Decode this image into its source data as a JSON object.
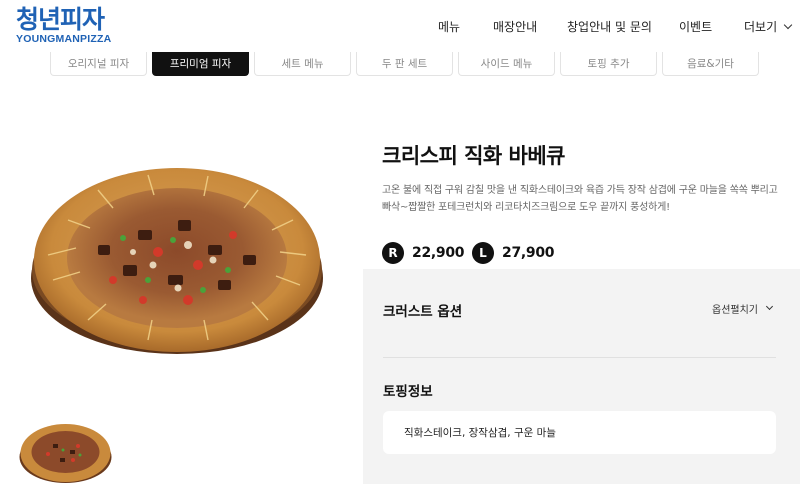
{
  "brand": {
    "logo_main": "청년피자",
    "logo_sub": "YOUNGMANPIZZA",
    "color": "#1f62b5"
  },
  "nav": {
    "items": [
      "메뉴",
      "매장안내",
      "창업안내 및 문의",
      "이벤트",
      "더보기"
    ]
  },
  "categories": {
    "tabs": [
      "오리지널 피자",
      "프리미엄 피자",
      "세트 메뉴",
      "두 판 세트",
      "사이드 메뉴",
      "토핑 추가",
      "음료&기타"
    ],
    "active": "프리미엄 피자"
  },
  "product": {
    "title": "크리스피 직화 바베큐",
    "description": "고온 불에 직접 구워 감칠 맛을 낸 직화스테이크와 육즙 가득 장작 삼겹에 구운 마늘을 쏙쏙 뿌리고 빠삭~짭짤한 포테크런치와 리코타치즈크림으로 도우 끝까지 풍성하게!",
    "prices": [
      {
        "size": "R",
        "price": "22,900"
      },
      {
        "size": "L",
        "price": "27,900"
      }
    ]
  },
  "options": {
    "crust_label": "크러스트 옵션",
    "open_label": "옵션펼치기",
    "topping_label": "토핑정보",
    "topping_info": "직화스테이크, 장작삼겹, 구운 마늘"
  },
  "icons": {
    "logo": "brand-logo",
    "dropdown": "chevron-down-icon"
  }
}
